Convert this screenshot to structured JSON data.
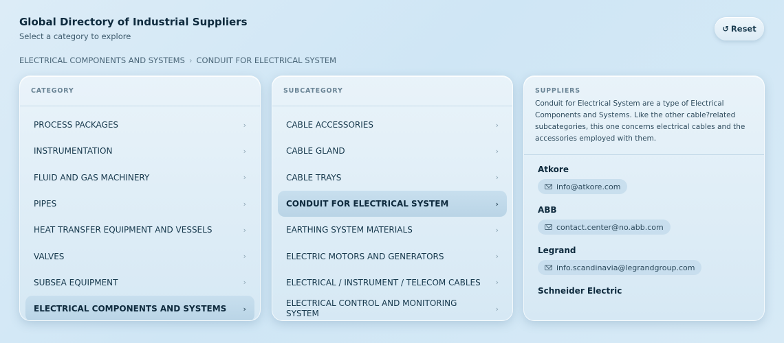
{
  "header": {
    "title": "Global Directory of Industrial Suppliers",
    "subtitle": "Select a category to explore",
    "reset_label": "Reset",
    "reset_icon": "↺"
  },
  "breadcrumb": [
    "ELECTRICAL COMPONENTS AND SYSTEMS",
    "CONDUIT FOR ELECTRICAL SYSTEM"
  ],
  "category": {
    "heading": "CATEGORY",
    "items": [
      "PROCESS PACKAGES",
      "INSTRUMENTATION",
      "FLUID AND GAS MACHINERY",
      "PIPES",
      "HEAT TRANSFER EQUIPMENT AND VESSELS",
      "VALVES",
      "SUBSEA EQUIPMENT",
      "ELECTRICAL COMPONENTS AND SYSTEMS"
    ],
    "selected": "ELECTRICAL COMPONENTS AND SYSTEMS"
  },
  "subcategory": {
    "heading": "SUBCATEGORY",
    "items": [
      "CABLE ACCESSORIES",
      "CABLE GLAND",
      "CABLE TRAYS",
      "CONDUIT FOR ELECTRICAL SYSTEM",
      "EARTHING SYSTEM MATERIALS",
      "ELECTRIC MOTORS AND GENERATORS",
      "ELECTRICAL / INSTRUMENT / TELECOM CABLES",
      "ELECTRICAL CONTROL AND MONITORING SYSTEM"
    ],
    "selected": "CONDUIT FOR ELECTRICAL SYSTEM"
  },
  "suppliers": {
    "heading": "SUPPLIERS",
    "description": "Conduit for Electrical System are a type of Electrical Components and Systems. Like the other cable?related subcategories, this one concerns electrical cables and the accessories employed with them.",
    "list": [
      {
        "name": "Atkore",
        "email": "info@atkore.com"
      },
      {
        "name": "ABB",
        "email": "contact.center@no.abb.com"
      },
      {
        "name": "Legrand",
        "email": "info.scandinavia@legrandgroup.com"
      },
      {
        "name": "Schneider Electric",
        "email": ""
      }
    ]
  },
  "chevron": "›"
}
